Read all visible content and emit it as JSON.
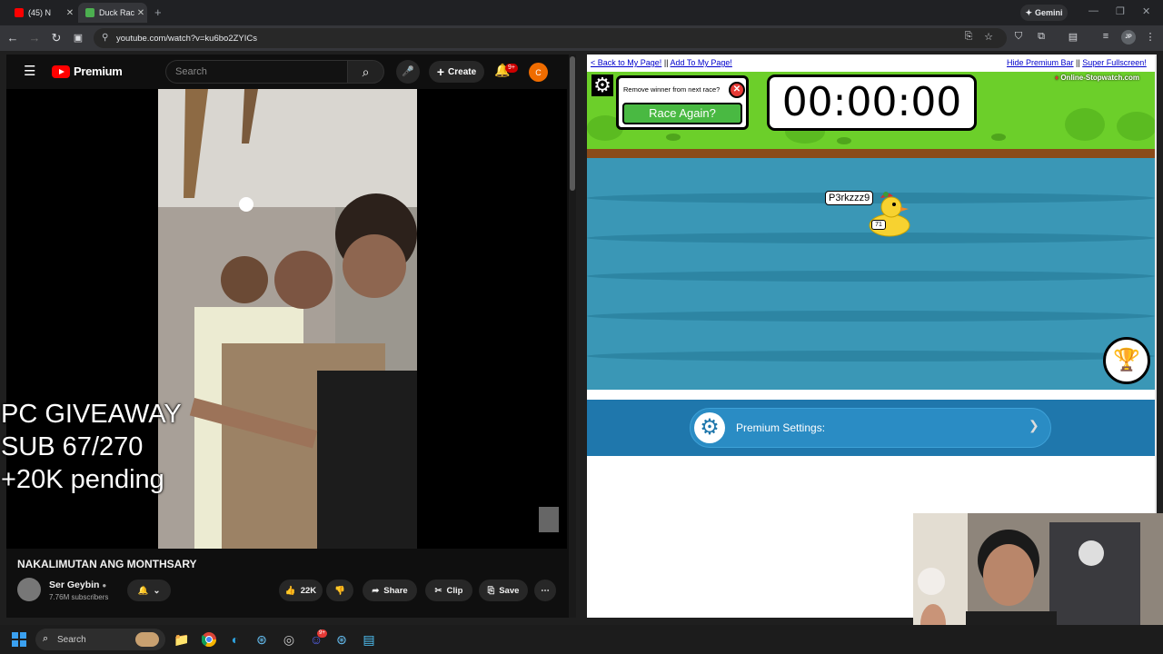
{
  "browser": {
    "tabs": [
      {
        "label": "(45) N",
        "favicon_color": "#ff0000",
        "active": false
      },
      {
        "label": "Duck Rac",
        "favicon_color": "#4caf50",
        "active": true
      }
    ],
    "gemini_label": "Gemini",
    "url": "youtube.com/watch?v=ku6bo2ZYICs",
    "profile_initials": "JP"
  },
  "youtube": {
    "logo_text": "Premium",
    "search_placeholder": "Search",
    "create_label": "Create",
    "notification_badge": "9+",
    "avatar_letter": "C",
    "overlay_lines": [
      "PC GIVEAWAY",
      "SUB 67/270",
      "+20K pending"
    ],
    "video_title": "NAKALIMUTAN ANG MONTHSARY",
    "channel_name": "Ser Geybin",
    "subscribers": "7.76M subscribers",
    "likes": "22K",
    "share_label": "Share",
    "clip_label": "Clip",
    "save_label": "Save"
  },
  "stopwatch": {
    "back_link": "< Back to My Page!",
    "sep1": "||",
    "add_link": "Add To My Page!",
    "hide_link": "Hide Premium Bar",
    "sep2": "||",
    "fullscreen_link": "Super Fullscreen!",
    "remove_question": "Remove winner from next race?",
    "race_again": "Race Again?",
    "timer": "00:00:00",
    "brand": "Online-Stopwatch.com",
    "duck_name": "P3rkzzz9",
    "duck_number": "71",
    "premium_settings": "Premium Settings:"
  },
  "taskbar": {
    "search_label": "Search",
    "discord_badge": "9+"
  },
  "colors": {
    "youtube_red": "#ff0000",
    "grass": "#6ccf2a",
    "water": "#3a97b6",
    "race_again_green": "#49b942",
    "premium_band": "#1f77ac"
  }
}
